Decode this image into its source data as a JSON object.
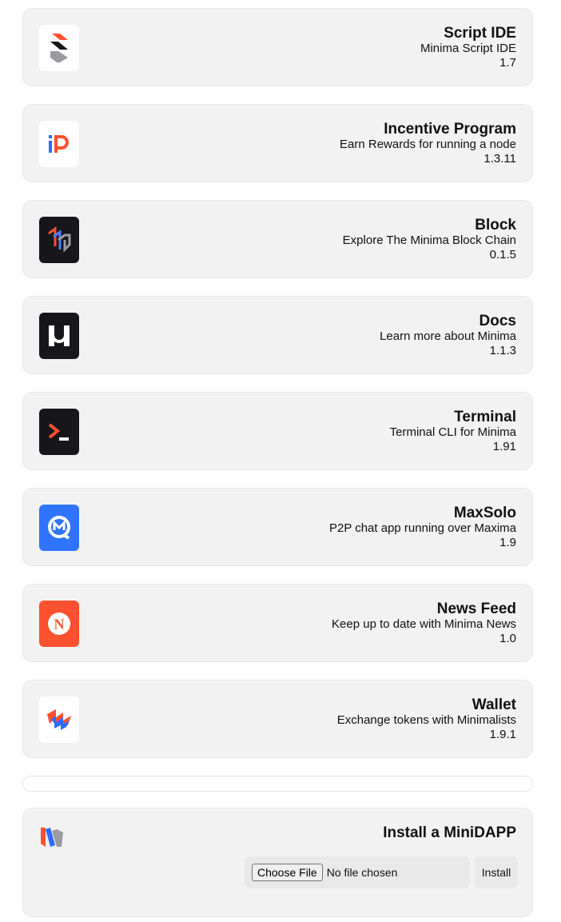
{
  "apps": [
    {
      "name": "Script IDE",
      "description": "Minima Script IDE",
      "version": "1.7",
      "icon": "script-ide-icon"
    },
    {
      "name": "Incentive Program",
      "description": "Earn Rewards for running a node",
      "version": "1.3.11",
      "icon": "incentive-program-icon"
    },
    {
      "name": "Block",
      "description": "Explore The Minima Block Chain",
      "version": "0.1.5",
      "icon": "block-explorer-icon"
    },
    {
      "name": "Docs",
      "description": "Learn more about Minima",
      "version": "1.1.3",
      "icon": "docs-icon"
    },
    {
      "name": "Terminal",
      "description": "Terminal CLI for Minima",
      "version": "1.91",
      "icon": "terminal-icon"
    },
    {
      "name": "MaxSolo",
      "description": "P2P chat app running over Maxima",
      "version": "1.9",
      "icon": "maxsolo-icon"
    },
    {
      "name": "News Feed",
      "description": "Keep up to date with Minima News",
      "version": "1.0",
      "icon": "news-feed-icon"
    },
    {
      "name": "Wallet",
      "description": "Exchange tokens with Minimalists",
      "version": "1.9.1",
      "icon": "wallet-icon"
    }
  ],
  "install": {
    "title": "Install a MiniDAPP",
    "choose_file_label": "Choose File",
    "file_status": "No file chosen",
    "install_label": "Install",
    "logo_icon": "minima-logo-icon"
  },
  "colors": {
    "card_bg": "#f2f2f2",
    "accent_orange": "#ff512f",
    "accent_blue": "#2f6bff",
    "dark_icon_bg": "#17171b"
  }
}
